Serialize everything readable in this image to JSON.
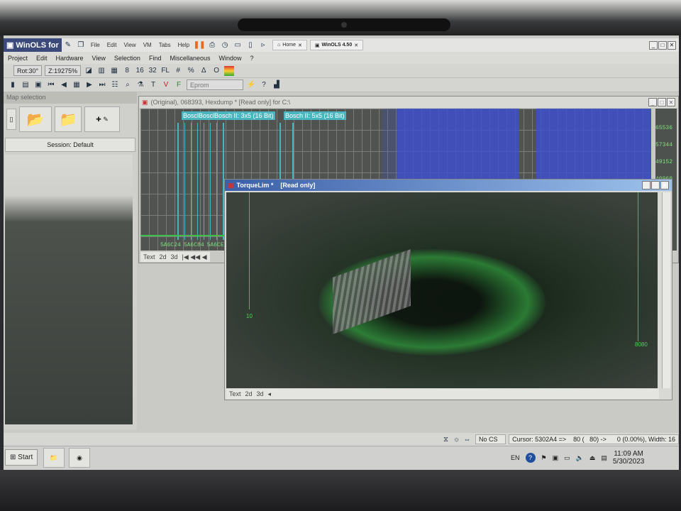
{
  "app": {
    "logo": "WinOLS for",
    "menu_top": [
      "File",
      "Edit",
      "View",
      "VM",
      "Tabs",
      "Help"
    ],
    "tabs": [
      {
        "label": "Home"
      },
      {
        "label": "WinOLS 4.50"
      }
    ]
  },
  "menubar": [
    "Project",
    "Edit",
    "Hardware",
    "View",
    "Selection",
    "Find",
    "Miscellaneous",
    "Window",
    "?"
  ],
  "toolbar1": {
    "rotation": "Rot:30°",
    "zoom": "Z:19275%",
    "bits": [
      "8",
      "16",
      "32",
      "FL"
    ]
  },
  "toolbar2": {
    "eprom": "Eprom"
  },
  "left_panel": {
    "title": "Map selection",
    "session": "Session: Default"
  },
  "hexdump": {
    "title": "(Original), 068393, Hexdump *   [Read only] for C:\\",
    "labels": [
      "BosclBosclBosch II: 3x5 (16 Bit)",
      "Bosch II: 5x5 (16 Bit)"
    ],
    "y_ticks": [
      "65536",
      "57344",
      "49152",
      "40960"
    ],
    "x_ticks": [
      "5A6C24",
      "5A6C84",
      "5A6CE"
    ],
    "tabs": [
      "Text",
      "2d",
      "3d"
    ]
  },
  "torquelim": {
    "title": "TorqueLim *",
    "readonly": "[Read only]",
    "axis_labels": [
      "10",
      "8080"
    ],
    "tabs": [
      "Text",
      "2d",
      "3d"
    ]
  },
  "status": {
    "cs": "No CS",
    "cursor": "Cursor: 5302A4 =>    80 (   80) ->      0 (0.00%), Width: 16"
  },
  "taskbar": {
    "start": "Start",
    "lang": "EN",
    "time": "11:09 AM",
    "date": "5/30/2023"
  }
}
